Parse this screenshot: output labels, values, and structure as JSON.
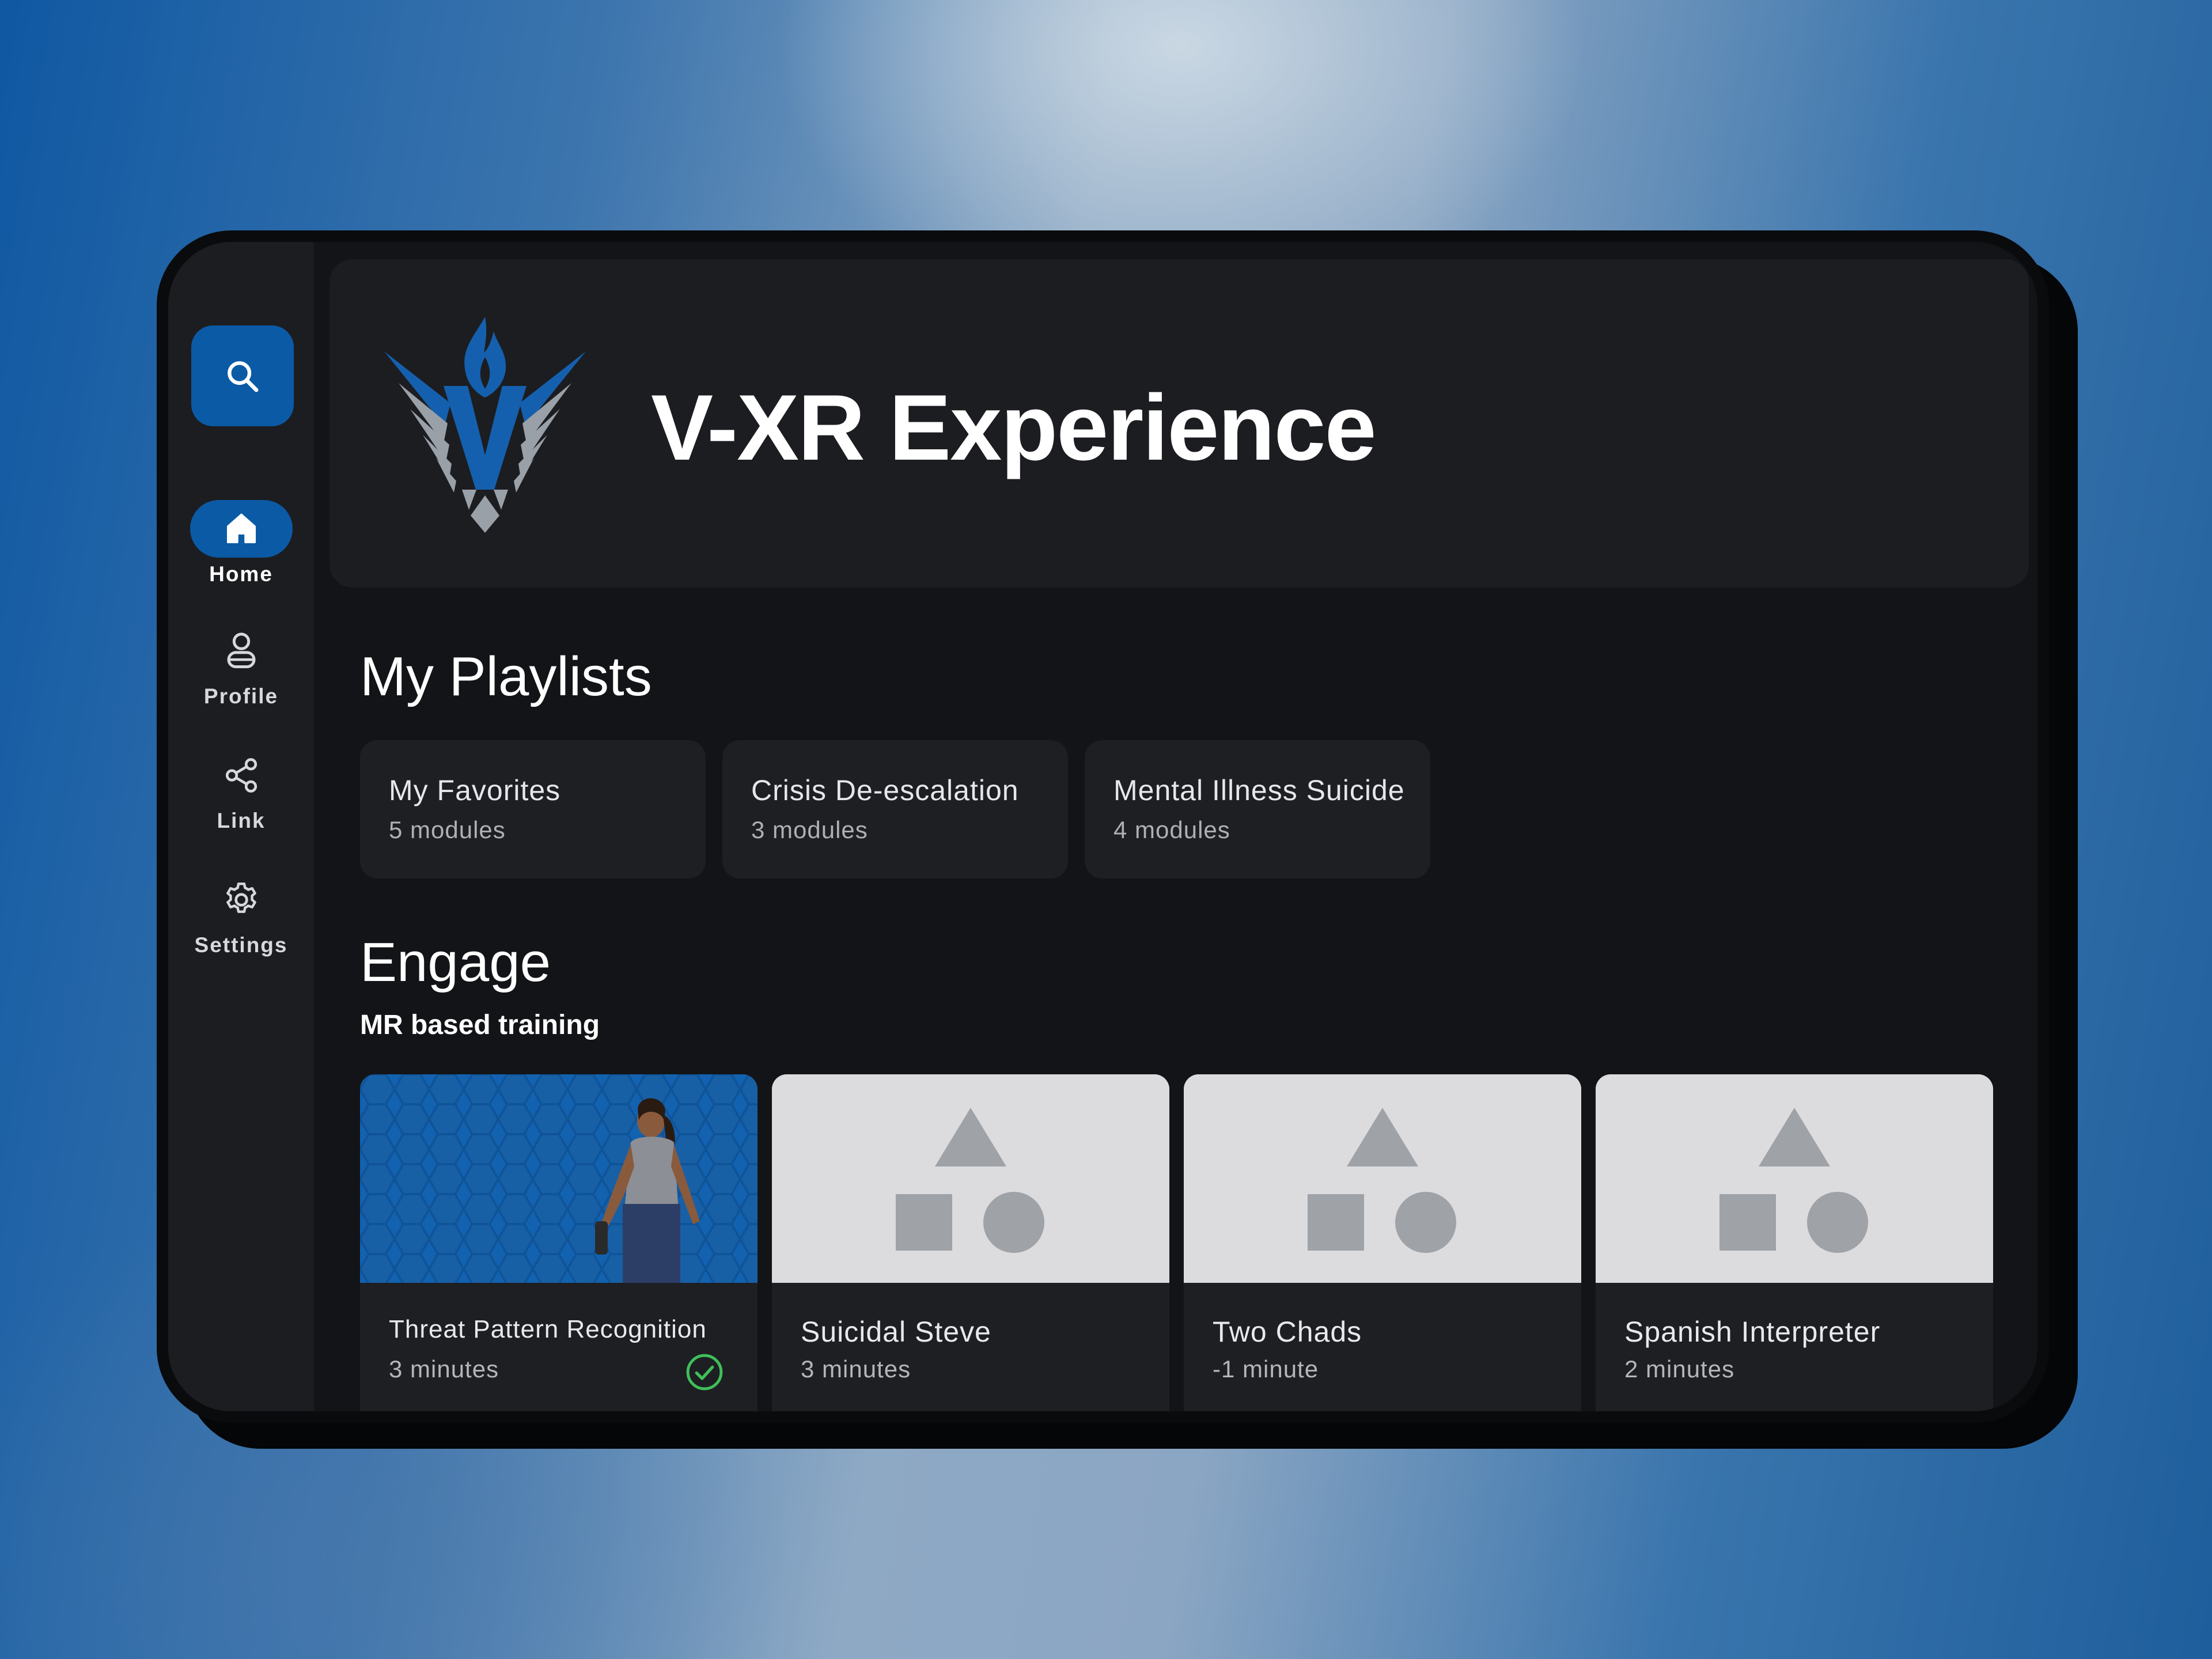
{
  "app": {
    "title": "V-XR Experience",
    "logo_icon": "v-xr-winged-flame-logo",
    "accent_color": "#0b5aa6"
  },
  "sidebar": {
    "search_icon": "search-icon",
    "items": [
      {
        "label": "Home",
        "icon": "home-icon",
        "active": true
      },
      {
        "label": "Profile",
        "icon": "user-icon",
        "active": false
      },
      {
        "label": "Link",
        "icon": "share-icon",
        "active": false
      },
      {
        "label": "Settings",
        "icon": "gear-icon",
        "active": false
      }
    ]
  },
  "playlists": {
    "title": "My Playlists",
    "items": [
      {
        "name": "My Favorites",
        "count": "5 modules"
      },
      {
        "name": "Crisis De-escalation",
        "count": "3 modules"
      },
      {
        "name": "Mental Illness Suicide",
        "count": "4 modules"
      }
    ]
  },
  "engage": {
    "title": "Engage",
    "subtitle": "MR based training",
    "modules": [
      {
        "name": "Threat Pattern Recognition",
        "duration": "3 minutes",
        "thumbnail": "photo",
        "completed": true,
        "status_icon": "check-circle-icon"
      },
      {
        "name": "Suicidal Steve",
        "duration": "3 minutes",
        "thumbnail": "placeholder-shapes",
        "completed": false
      },
      {
        "name": "Two Chads",
        "duration": "-1 minute",
        "thumbnail": "placeholder-shapes",
        "completed": false
      },
      {
        "name": "Spanish Interpreter",
        "duration": "2 minutes",
        "thumbnail": "placeholder-shapes",
        "completed": false
      }
    ]
  }
}
